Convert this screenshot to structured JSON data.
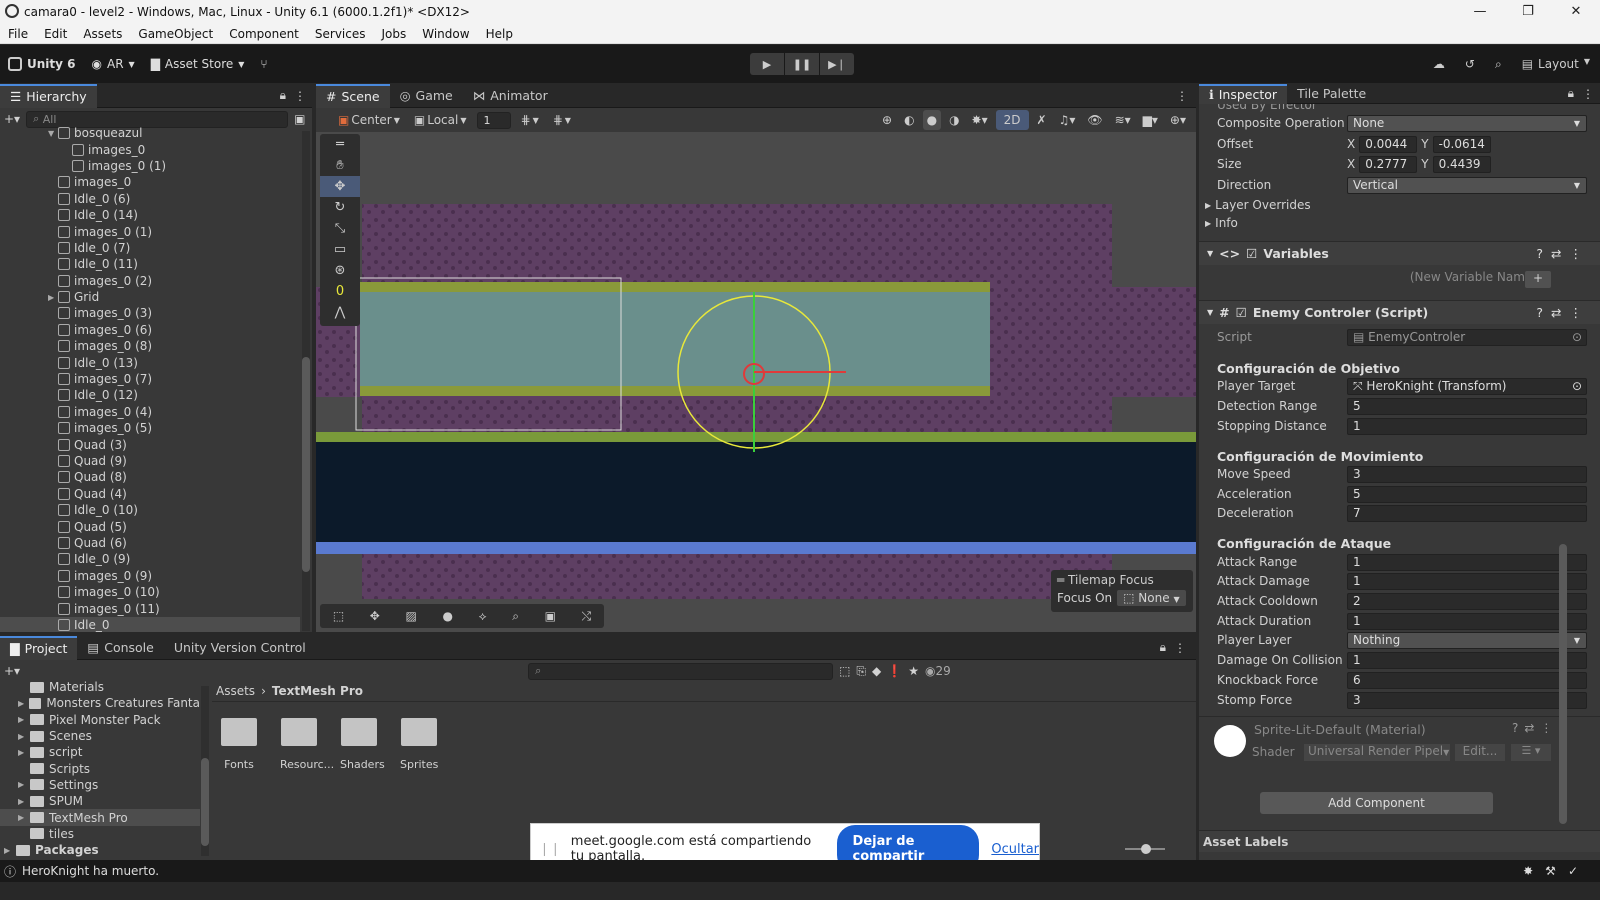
{
  "window": {
    "title": "camara0 - level2 - Windows, Mac, Linux - Unity 6.1 (6000.1.2f1)* <DX12>"
  },
  "menu": [
    "File",
    "Edit",
    "Assets",
    "GameObject",
    "Component",
    "Services",
    "Jobs",
    "Window",
    "Help"
  ],
  "toolbar": {
    "unity": "Unity 6",
    "ar": "AR",
    "asset_store": "Asset Store",
    "layout": "Layout"
  },
  "hierarchy": {
    "tab": "Hierarchy",
    "search_placeholder": "All",
    "items": [
      {
        "name": "bosqueazul",
        "indent": 1,
        "arrow": "▼"
      },
      {
        "name": "images_0",
        "indent": 2,
        "arrow": ""
      },
      {
        "name": "images_0 (1)",
        "indent": 2,
        "arrow": ""
      },
      {
        "name": "images_0",
        "indent": 1,
        "arrow": ""
      },
      {
        "name": "Idle_0 (6)",
        "indent": 1,
        "arrow": ""
      },
      {
        "name": "Idle_0 (14)",
        "indent": 1,
        "arrow": ""
      },
      {
        "name": "images_0 (1)",
        "indent": 1,
        "arrow": ""
      },
      {
        "name": "Idle_0 (7)",
        "indent": 1,
        "arrow": ""
      },
      {
        "name": "Idle_0 (11)",
        "indent": 1,
        "arrow": ""
      },
      {
        "name": "images_0 (2)",
        "indent": 1,
        "arrow": ""
      },
      {
        "name": "Grid",
        "indent": 1,
        "arrow": "▶"
      },
      {
        "name": "images_0 (3)",
        "indent": 1,
        "arrow": ""
      },
      {
        "name": "images_0 (6)",
        "indent": 1,
        "arrow": ""
      },
      {
        "name": "images_0 (8)",
        "indent": 1,
        "arrow": ""
      },
      {
        "name": "Idle_0 (13)",
        "indent": 1,
        "arrow": ""
      },
      {
        "name": "images_0 (7)",
        "indent": 1,
        "arrow": ""
      },
      {
        "name": "Idle_0 (12)",
        "indent": 1,
        "arrow": ""
      },
      {
        "name": "images_0 (4)",
        "indent": 1,
        "arrow": ""
      },
      {
        "name": "images_0 (5)",
        "indent": 1,
        "arrow": ""
      },
      {
        "name": "Quad (3)",
        "indent": 1,
        "arrow": ""
      },
      {
        "name": "Quad (9)",
        "indent": 1,
        "arrow": ""
      },
      {
        "name": "Quad (8)",
        "indent": 1,
        "arrow": ""
      },
      {
        "name": "Quad (4)",
        "indent": 1,
        "arrow": ""
      },
      {
        "name": "Idle_0 (10)",
        "indent": 1,
        "arrow": ""
      },
      {
        "name": "Quad (5)",
        "indent": 1,
        "arrow": ""
      },
      {
        "name": "Quad (6)",
        "indent": 1,
        "arrow": ""
      },
      {
        "name": "Idle_0 (9)",
        "indent": 1,
        "arrow": ""
      },
      {
        "name": "images_0 (9)",
        "indent": 1,
        "arrow": ""
      },
      {
        "name": "images_0 (10)",
        "indent": 1,
        "arrow": ""
      },
      {
        "name": "images_0 (11)",
        "indent": 1,
        "arrow": ""
      },
      {
        "name": "Idle_0",
        "indent": 1,
        "arrow": ""
      }
    ]
  },
  "scene": {
    "tabs": [
      "Scene",
      "Game",
      "Animator"
    ],
    "pivot": "Center",
    "space": "Local",
    "grid_value": "1",
    "mode_2d": "2D",
    "tilemap_focus_title": "Tilemap Focus",
    "focus_on_label": "Focus On",
    "focus_on_value": "None"
  },
  "inspector": {
    "tabs": [
      "Inspector",
      "Tile Palette"
    ],
    "cut_label": "Used By Effector",
    "collider": {
      "composite_label": "Composite Operation",
      "composite_value": "None",
      "offset_label": "Offset",
      "offset_x": "0.0044",
      "offset_y": "-0.0614",
      "size_label": "Size",
      "size_x": "0.2777",
      "size_y": "0.4439",
      "direction_label": "Direction",
      "direction_value": "Vertical",
      "layer_overrides": "Layer Overrides",
      "info": "Info"
    },
    "variables": {
      "title": "Variables",
      "placeholder": "(New Variable Name)"
    },
    "enemy": {
      "title": "Enemy Controler (Script)",
      "script_label": "Script",
      "script_value": "EnemyControler",
      "objetivo": "Configuración de Objetivo",
      "player_target_label": "Player Target",
      "player_target_value": "HeroKnight (Transform)",
      "detection_label": "Detection Range",
      "detection_value": "5",
      "stopping_label": "Stopping Distance",
      "stopping_value": "1",
      "movimiento": "Configuración de Movimiento",
      "move_speed_label": "Move Speed",
      "move_speed_value": "3",
      "accel_label": "Acceleration",
      "accel_value": "5",
      "decel_label": "Deceleration",
      "decel_value": "7",
      "ataque": "Configuración de Ataque",
      "attack_range_label": "Attack Range",
      "attack_range_value": "1",
      "attack_damage_label": "Attack Damage",
      "attack_damage_value": "1",
      "attack_cooldown_label": "Attack Cooldown",
      "attack_cooldown_value": "2",
      "attack_duration_label": "Attack Duration",
      "attack_duration_value": "1",
      "player_layer_label": "Player Layer",
      "player_layer_value": "Nothing",
      "damage_collision_label": "Damage On Collision",
      "damage_collision_value": "1",
      "knockback_label": "Knockback Force",
      "knockback_value": "6",
      "stomp_label": "Stomp Force",
      "stomp_value": "3"
    },
    "material": {
      "title": "Sprite-Lit-Default (Material)",
      "shader_label": "Shader",
      "shader_value": "Universal Render Pipel",
      "edit": "Edit..."
    },
    "add_component": "Add Component",
    "asset_labels": "Asset Labels"
  },
  "project": {
    "tabs": [
      "Project",
      "Console",
      "Unity Version Control"
    ],
    "count": "29",
    "breadcrumb_root": "Assets",
    "breadcrumb_leaf": "TextMesh Pro",
    "tree": [
      {
        "name": "Materials",
        "arrow": "",
        "indent": 1,
        "sel": false
      },
      {
        "name": "Monsters Creatures Fanta",
        "arrow": "▶",
        "indent": 1,
        "sel": false
      },
      {
        "name": "Pixel Monster Pack",
        "arrow": "▶",
        "indent": 1,
        "sel": false
      },
      {
        "name": "Scenes",
        "arrow": "▶",
        "indent": 1,
        "sel": false
      },
      {
        "name": "script",
        "arrow": "▶",
        "indent": 1,
        "sel": false
      },
      {
        "name": "Scripts",
        "arrow": "",
        "indent": 1,
        "sel": false
      },
      {
        "name": "Settings",
        "arrow": "▶",
        "indent": 1,
        "sel": false
      },
      {
        "name": "SPUM",
        "arrow": "▶",
        "indent": 1,
        "sel": false
      },
      {
        "name": "TextMesh Pro",
        "arrow": "▶",
        "indent": 1,
        "sel": true
      },
      {
        "name": "tiles",
        "arrow": "",
        "indent": 1,
        "sel": false
      },
      {
        "name": "Packages",
        "arrow": "▶",
        "indent": 0,
        "sel": false
      }
    ],
    "folders": [
      "Fonts",
      "Resourc...",
      "Shaders",
      "Sprites"
    ]
  },
  "share": {
    "text": "meet.google.com está compartiendo tu pantalla.",
    "stop": "Dejar de compartir",
    "hide": "Ocultar"
  },
  "status": {
    "message": "HeroKnight ha muerto."
  }
}
